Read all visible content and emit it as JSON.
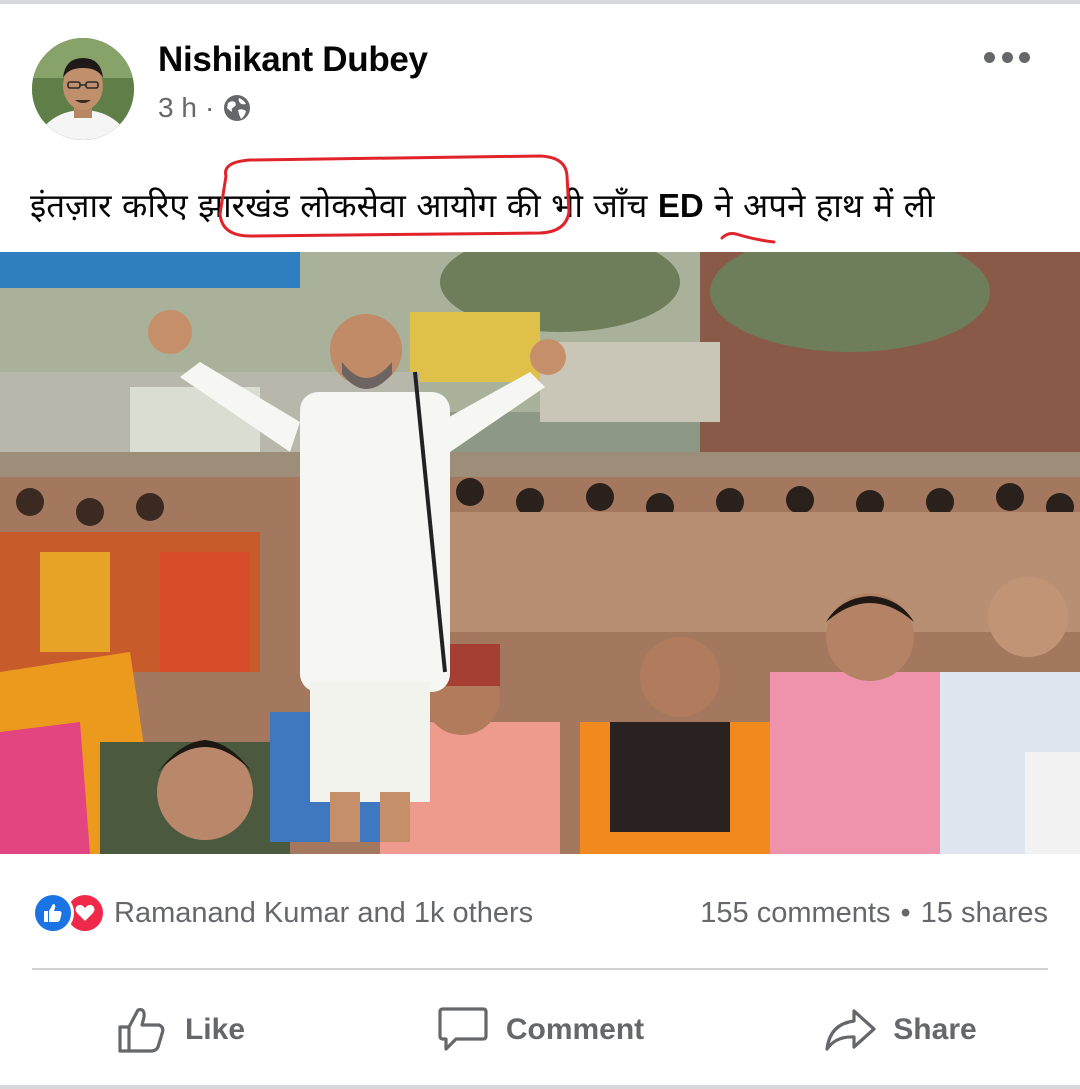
{
  "post": {
    "author": "Nishikant Dubey",
    "time": "3 h",
    "separator": "·",
    "privacy_icon": "globe-icon",
    "more_icon": "more-horizontal-icon",
    "text": {
      "part1": "इंतज़ार करिए ",
      "highlight": "झारखंड लोकसेवा आयोग",
      "part2": " की भी जाँच ",
      "ed": "ED",
      "part3": " ने अपने हाथ में ली"
    },
    "annotation_color": "#e0242a"
  },
  "stats": {
    "reaction_icons": [
      "like-reaction-icon",
      "love-reaction-icon"
    ],
    "reactions_text": "Ramanand Kumar and 1k others",
    "comments": "155 comments",
    "dot": "•",
    "shares": "15 shares"
  },
  "actions": {
    "like": "Like",
    "comment": "Comment",
    "share": "Share"
  },
  "colors": {
    "like_blue": "#1b74e4",
    "love_red": "#f02849",
    "secondary_text": "#65676b"
  }
}
